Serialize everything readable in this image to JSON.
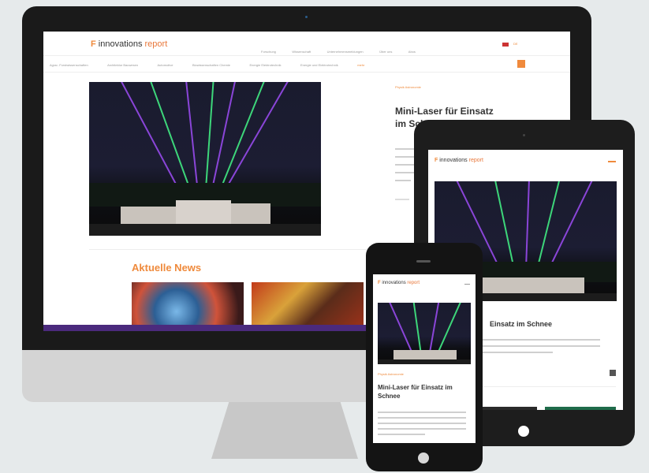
{
  "desktop": {
    "logo_brand": "innovations",
    "logo_accent": "report",
    "top_nav": [
      "Forschung",
      "Wissenschaft",
      "Unternehmensmeldungen",
      "Über uns",
      "Abos"
    ],
    "lang": "DE",
    "sub_nav": [
      "Agrar- Forstwissenschaften",
      "Architektur Bauwesen",
      "Automotive",
      "Biowissenschaften Chemie",
      "Energie Elektrotechnik",
      "Energie und Elektrotechnik",
      "mehr"
    ],
    "article_category": "Physik Astronomie",
    "article_title_line1": "Mini-Laser für Einsatz",
    "article_title_line2": "im Schnee",
    "section_heading": "Aktuelle News"
  },
  "tablet": {
    "logo_brand": "innovations",
    "logo_accent": "report",
    "article_title_fragment": "Einsatz im Schnee"
  },
  "phone": {
    "logo_brand": "innovations",
    "logo_accent": "report",
    "category": "Physik Astronomie",
    "article_title": "Mini-Laser für Einsatz im Schnee"
  },
  "colors": {
    "accent": "#ef8a3c",
    "purple": "#4b2a7d",
    "laser_green": "#3dd67a",
    "laser_purple": "#8a45d8"
  }
}
